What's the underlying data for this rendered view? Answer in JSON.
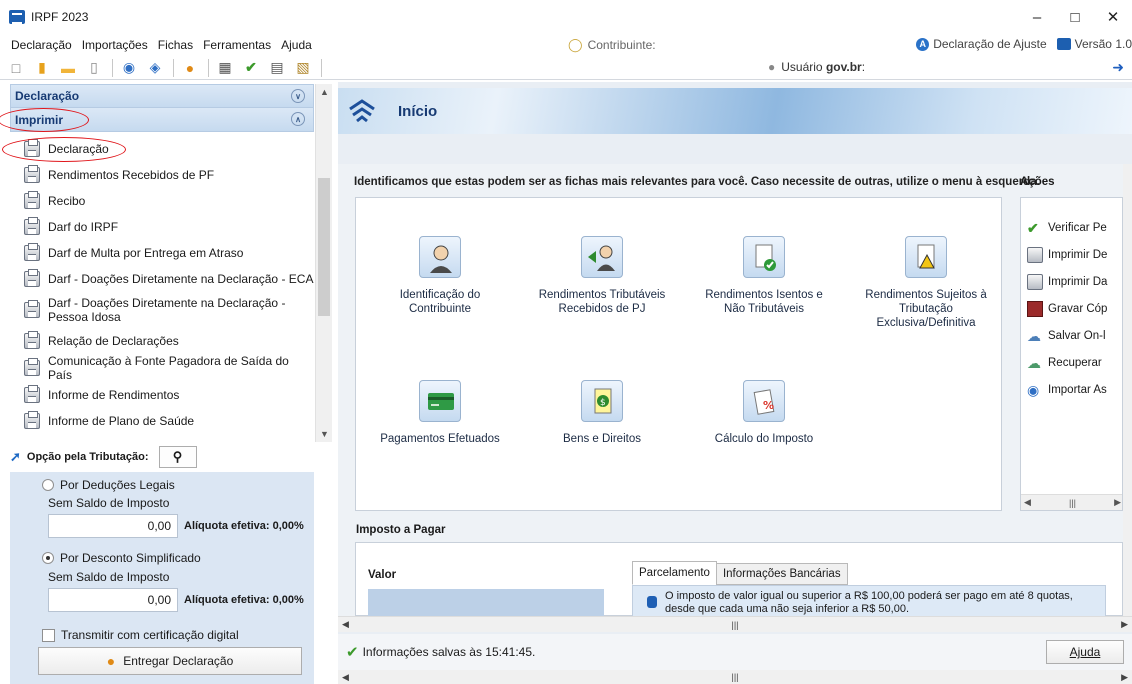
{
  "window": {
    "title": "IRPF 2023"
  },
  "menu": [
    "Declaração",
    "Importações",
    "Fichas",
    "Ferramentas",
    "Ajuda"
  ],
  "menubar": {
    "contribuinte": "Contribuinte:",
    "declaracao_tipo": "Declaração de Ajuste",
    "versao": "Versão 1.0"
  },
  "toolbar": {
    "usuario_prefix": "Usuário",
    "usuario_value": "gov.br",
    "usuario_suffix": ":"
  },
  "sidebar": {
    "sections": [
      "Declaração",
      "Imprimir"
    ],
    "items": [
      "Declaração",
      "Rendimentos Recebidos de PF",
      "Recibo",
      "Darf do IRPF",
      "Darf de Multa por Entrega em Atraso",
      "Darf - Doações Diretamente na Declaração - ECA",
      "Darf - Doações Diretamente na Declaração - Pessoa Idosa",
      "Relação de Declarações",
      "Comunicação à Fonte Pagadora de Saída do País",
      "Informe de Rendimentos",
      "Informe de Plano de Saúde"
    ]
  },
  "opcao": {
    "title": "Opção pela Tributação:",
    "deducoes_label": "Por Deduções Legais",
    "deducoes_sub": "Sem Saldo de Imposto",
    "deducoes_value": "0,00",
    "deducoes_aliquota": "Alíquota efetiva: 0,00%",
    "simplificado_label": "Por Desconto Simplificado",
    "simplificado_sub": "Sem Saldo de Imposto",
    "simplificado_value": "0,00",
    "simplificado_aliquota": "Alíquota efetiva: 0,00%",
    "transmitir": "Transmitir com certificação digital",
    "entregar": "Entregar Declaração"
  },
  "main": {
    "title": "Início",
    "intro": "Identificamos que estas podem ser as fichas mais relevantes para você. Caso necessite de outras, utilize o menu à esquerda.",
    "tiles": [
      "Identificação do Contribuinte",
      "Rendimentos Tributáveis Recebidos de PJ",
      "Rendimentos Isentos e Não Tributáveis",
      "Rendimentos Sujeitos à Tributação Exclusiva/Definitiva",
      "Pagamentos Efetuados",
      "Bens e Direitos",
      "Cálculo do Imposto"
    ],
    "acoes_title": "Ações",
    "acoes": [
      "Verificar Pe",
      "Imprimir De",
      "Imprimir Da",
      "Gravar Cóp",
      "Salvar On-l",
      "Recuperar",
      "Importar As"
    ],
    "imposto_title": "Imposto a Pagar",
    "valor_label": "Valor",
    "tabs": [
      "Parcelamento",
      "Informações Bancárias"
    ],
    "parcelamento_text": "O imposto de valor igual ou superior a R$ 100,00 poderá ser pago em até 8 quotas, desde que cada uma não seja inferior a R$ 50,00."
  },
  "status": {
    "text": "Informações salvas às 15:41:45.",
    "ajuda": "Ajuda"
  },
  "colors": {
    "accent": "#173a73",
    "highlight_red": "#e0161b",
    "panel_blue": "#dbe6f3"
  }
}
